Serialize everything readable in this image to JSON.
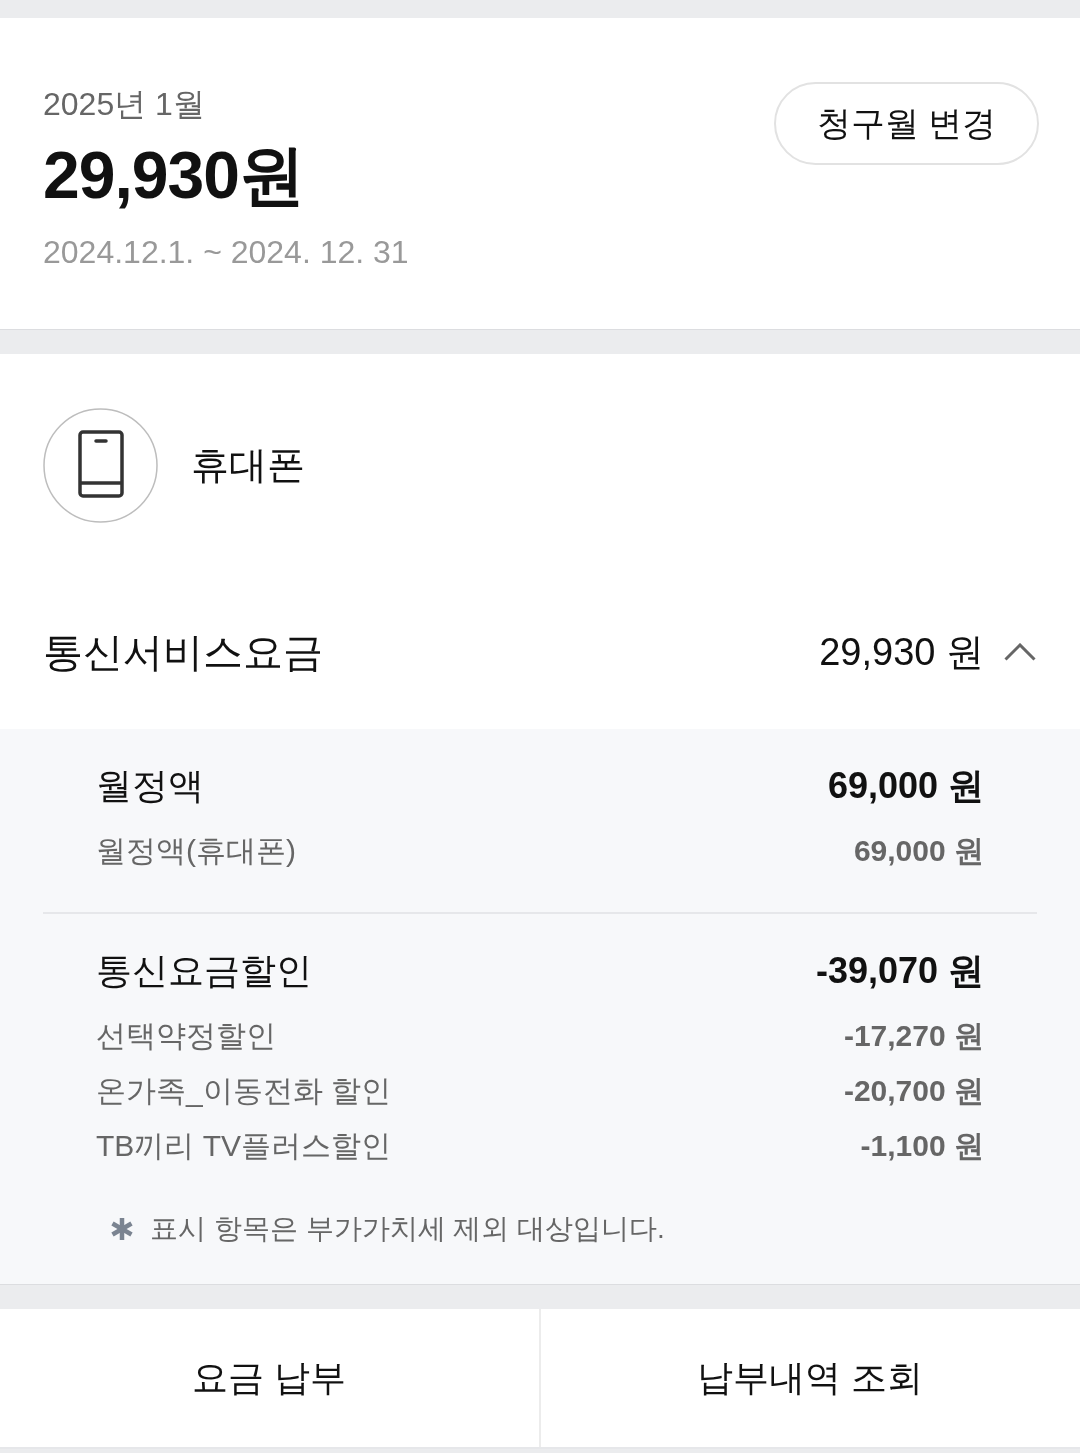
{
  "header": {
    "billing_month": "2025년 1월",
    "total": "29,930원",
    "period": "2024.12.1. ~ 2024. 12. 31",
    "change_month_button": "청구월 변경"
  },
  "service": {
    "name": "휴대폰"
  },
  "charge_summary": {
    "label": "통신서비스요금",
    "amount": "29,930 원",
    "expanded": true
  },
  "groups": [
    {
      "title": "월정액",
      "amount": "69,000 원",
      "items": [
        {
          "label": "월정액(휴대폰)",
          "amount": "69,000 원"
        }
      ]
    },
    {
      "title": "통신요금할인",
      "amount": "-39,070 원",
      "items": [
        {
          "label": "선택약정할인",
          "amount": "-17,270 원"
        },
        {
          "label": "온가족_이동전화 할인",
          "amount": "-20,700 원"
        },
        {
          "label": "TB끼리 TV플러스할인",
          "amount": "-1,100 원"
        }
      ]
    }
  ],
  "note": "표시 항목은 부가가치세 제외 대상입니다.",
  "buttons": [
    "요금 납부",
    "납부내역 조회"
  ]
}
